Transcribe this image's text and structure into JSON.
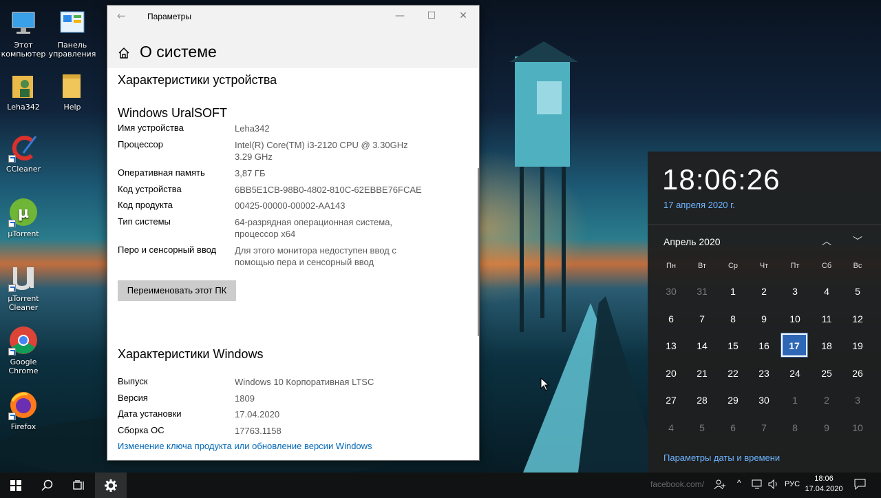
{
  "desktop": {
    "icons": [
      {
        "label": "Этот\nкомпьютер"
      },
      {
        "label": "Панель\nуправления"
      },
      {
        "label": "Leha342"
      },
      {
        "label": "Help"
      },
      {
        "label": "CCleaner"
      },
      {
        "label": "µTorrent"
      },
      {
        "label": "µTorrent\nCleaner"
      },
      {
        "label": "Google\nChrome"
      },
      {
        "label": "Firefox"
      }
    ]
  },
  "window": {
    "title": "Параметры",
    "back_icon": "back-arrow-icon",
    "controls": {
      "minimize": "—",
      "maximize": "☐",
      "close": "✕"
    },
    "page_title": "О системе",
    "device_section": "Характеристики устройства",
    "device_name_heading": "Windows UralSOFT",
    "device_specs": [
      {
        "label": "Имя устройства",
        "value": "Leha342"
      },
      {
        "label": "Процессор",
        "value": "Intel(R) Core(TM) i3-2120 CPU @ 3.30GHz\n3.29 GHz"
      },
      {
        "label": "Оперативная память",
        "value": "3,87 ГБ"
      },
      {
        "label": "Код устройства",
        "value": "6BB5E1CB-98B0-4802-810C-62EBBE76FCAE"
      },
      {
        "label": "Код продукта",
        "value": "00425-00000-00002-AA143"
      },
      {
        "label": "Тип системы",
        "value": "64-разрядная операционная система,\nпроцессор x64"
      },
      {
        "label": "Перо и сенсорный ввод",
        "value": "Для этого монитора недоступен ввод с\nпомощью пера и сенсорный ввод"
      }
    ],
    "rename_button": "Переименовать этот ПК",
    "windows_section": "Характеристики Windows",
    "windows_specs": [
      {
        "label": "Выпуск",
        "value": "Windows 10 Корпоративная LTSC"
      },
      {
        "label": "Версия",
        "value": "1809"
      },
      {
        "label": "Дата установки",
        "value": "17.04.2020"
      },
      {
        "label": "Сборка ОС",
        "value": "17763.1158"
      }
    ],
    "change_key_link": "Изменение ключа продукта или обновление версии Windows"
  },
  "flyout": {
    "time": "18:06:26",
    "date": "17 апреля 2020 г.",
    "month": "Апрель 2020",
    "weekdays": [
      "Пн",
      "Вт",
      "Ср",
      "Чт",
      "Пт",
      "Сб",
      "Вс"
    ],
    "days": [
      {
        "d": "30",
        "dim": true
      },
      {
        "d": "31",
        "dim": true
      },
      {
        "d": "1"
      },
      {
        "d": "2"
      },
      {
        "d": "3"
      },
      {
        "d": "4"
      },
      {
        "d": "5"
      },
      {
        "d": "6"
      },
      {
        "d": "7"
      },
      {
        "d": "8"
      },
      {
        "d": "9"
      },
      {
        "d": "10"
      },
      {
        "d": "11"
      },
      {
        "d": "12"
      },
      {
        "d": "13"
      },
      {
        "d": "14"
      },
      {
        "d": "15"
      },
      {
        "d": "16"
      },
      {
        "d": "17",
        "today": true
      },
      {
        "d": "18"
      },
      {
        "d": "19"
      },
      {
        "d": "20"
      },
      {
        "d": "21"
      },
      {
        "d": "22"
      },
      {
        "d": "23"
      },
      {
        "d": "24"
      },
      {
        "d": "25"
      },
      {
        "d": "26"
      },
      {
        "d": "27"
      },
      {
        "d": "28"
      },
      {
        "d": "29"
      },
      {
        "d": "30"
      },
      {
        "d": "1",
        "dim": true
      },
      {
        "d": "2",
        "dim": true
      },
      {
        "d": "3",
        "dim": true
      },
      {
        "d": "4",
        "dim": true
      },
      {
        "d": "5",
        "dim": true
      },
      {
        "d": "6",
        "dim": true
      },
      {
        "d": "7",
        "dim": true
      },
      {
        "d": "8",
        "dim": true
      },
      {
        "d": "9",
        "dim": true
      },
      {
        "d": "10",
        "dim": true
      }
    ],
    "settings_link": "Параметры даты и времени"
  },
  "taskbar": {
    "watermark": "facebook.com/",
    "language": "РУС",
    "time": "18:06",
    "date": "17.04.2020"
  },
  "colors": {
    "accent": "#2e67b5",
    "link": "#0067b8",
    "flyout_link": "#6cb4ff"
  }
}
